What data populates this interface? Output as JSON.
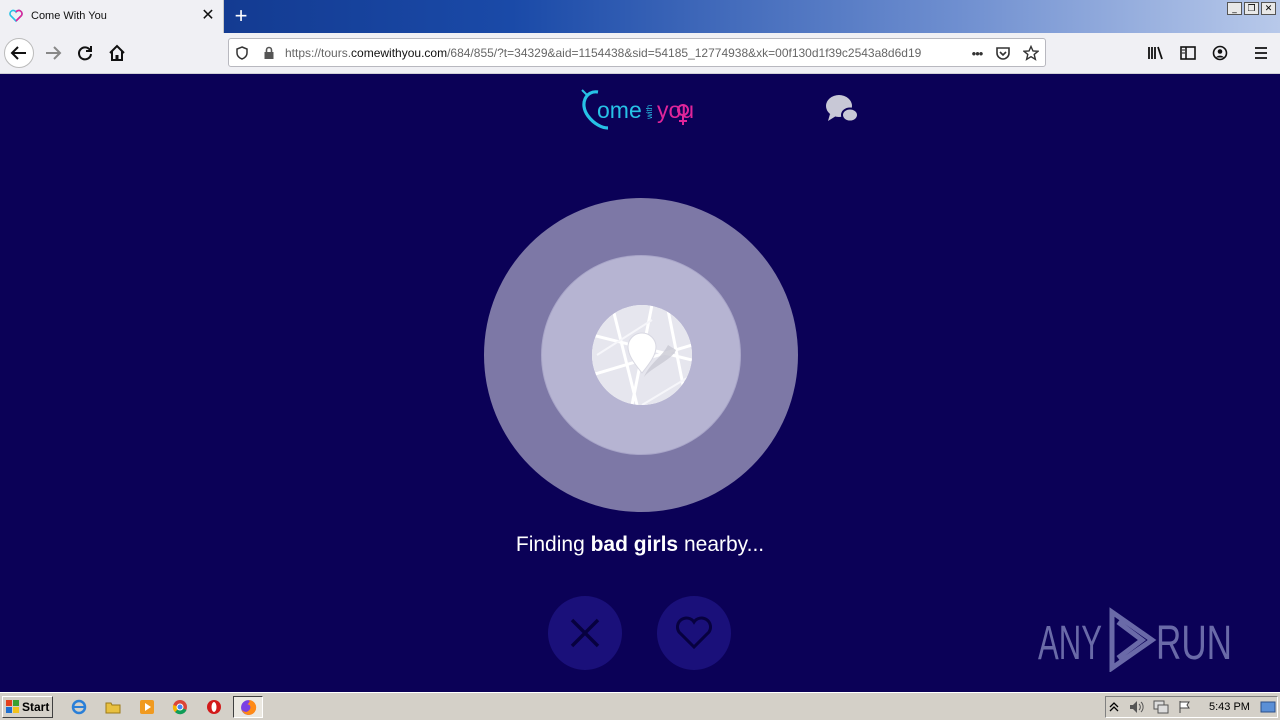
{
  "browser": {
    "tab_title": "Come With You",
    "new_tab_label": "+",
    "url_prefix": "https://tours.",
    "url_domain": "comewithyou.com",
    "url_rest": "/684/855/?t=34329&aid=1154438&sid=54185_12774938&xk=00f130d1f39c2543a8d6d19",
    "more_label": "•••",
    "window_controls": [
      "_",
      "❐",
      "✕"
    ]
  },
  "page": {
    "logo": {
      "part1": "ome",
      "part2": "with",
      "part3": "you"
    },
    "finding_prefix": "Finding ",
    "finding_bold": "bad girls",
    "finding_suffix": " nearby...",
    "watermark": "ANY RUN",
    "colors": {
      "background": "#0b0157",
      "logo_cyan": "#27c2e6",
      "logo_pink": "#e0259a"
    }
  },
  "taskbar": {
    "start_label": "Start",
    "clock": "5:43 PM"
  }
}
